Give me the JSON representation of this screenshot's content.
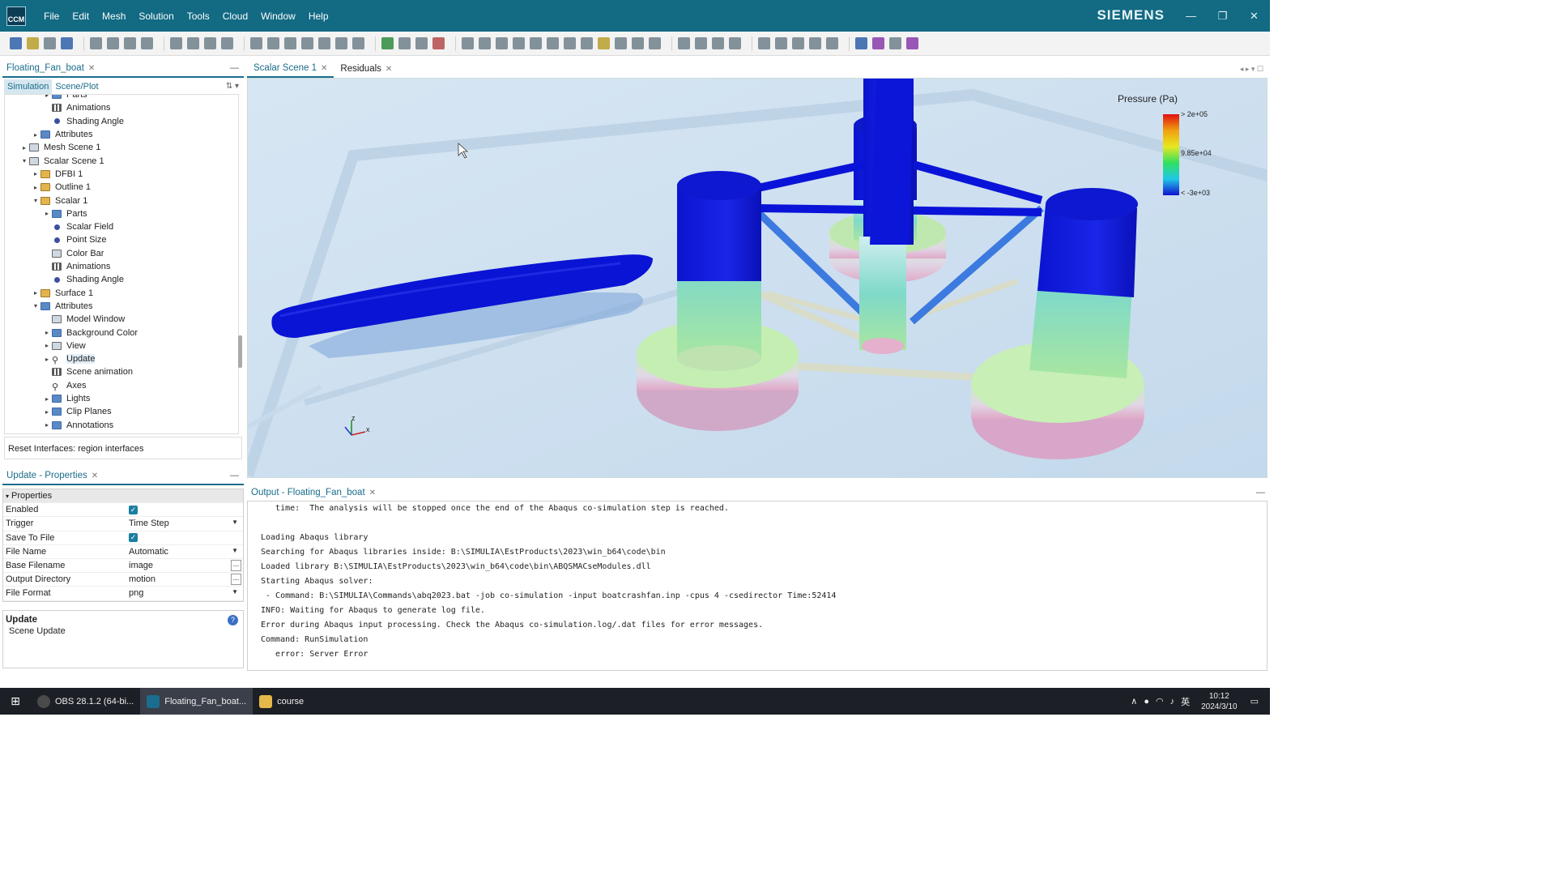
{
  "titlebar": {
    "app_logo": "CCM",
    "menus": [
      "File",
      "Edit",
      "Mesh",
      "Solution",
      "Tools",
      "Cloud",
      "Window",
      "Help"
    ],
    "brand": "SIEMENS"
  },
  "left_panel": {
    "tab_label": "Floating_Fan_boat",
    "subtabs": [
      "Simulation",
      "Scene/Plot"
    ],
    "tree": [
      {
        "label": "Parts",
        "indent": 3,
        "arrow": "▸",
        "icon": "folder"
      },
      {
        "label": "Animations",
        "indent": 3,
        "arrow": "",
        "icon": "anim"
      },
      {
        "label": "Shading Angle",
        "indent": 3,
        "arrow": "",
        "icon": "dot"
      },
      {
        "label": "Attributes",
        "indent": 2,
        "arrow": "▸",
        "icon": "folder"
      },
      {
        "label": "Mesh Scene 1",
        "indent": 1,
        "arrow": "▸",
        "icon": "scene"
      },
      {
        "label": "Scalar Scene 1",
        "indent": 1,
        "arrow": "▾",
        "icon": "scene"
      },
      {
        "label": "DFBI 1",
        "indent": 2,
        "arrow": "▸",
        "icon": "yellow"
      },
      {
        "label": "Outline 1",
        "indent": 2,
        "arrow": "▸",
        "icon": "yellow"
      },
      {
        "label": "Scalar 1",
        "indent": 2,
        "arrow": "▾",
        "icon": "yellow"
      },
      {
        "label": "Parts",
        "indent": 3,
        "arrow": "▸",
        "icon": "folder"
      },
      {
        "label": "Scalar Field",
        "indent": 3,
        "arrow": "",
        "icon": "dot"
      },
      {
        "label": "Point Size",
        "indent": 3,
        "arrow": "",
        "icon": "dot"
      },
      {
        "label": "Color Bar",
        "indent": 3,
        "arrow": "",
        "icon": "scene"
      },
      {
        "label": "Animations",
        "indent": 3,
        "arrow": "",
        "icon": "anim"
      },
      {
        "label": "Shading Angle",
        "indent": 3,
        "arrow": "",
        "icon": "dot"
      },
      {
        "label": "Surface 1",
        "indent": 2,
        "arrow": "▸",
        "icon": "yellow"
      },
      {
        "label": "Attributes",
        "indent": 2,
        "arrow": "▾",
        "icon": "folder"
      },
      {
        "label": "Model Window",
        "indent": 3,
        "arrow": "",
        "icon": "scene"
      },
      {
        "label": "Background Color",
        "indent": 3,
        "arrow": "▸",
        "icon": "folder"
      },
      {
        "label": "View",
        "indent": 3,
        "arrow": "▸",
        "icon": "scene"
      },
      {
        "label": "Update",
        "indent": 3,
        "arrow": "▸",
        "icon": "run",
        "selected": true
      },
      {
        "label": "Scene animation",
        "indent": 3,
        "arrow": "",
        "icon": "anim"
      },
      {
        "label": "Axes",
        "indent": 3,
        "arrow": "",
        "icon": "run"
      },
      {
        "label": "Lights",
        "indent": 3,
        "arrow": "▸",
        "icon": "folder"
      },
      {
        "label": "Clip Planes",
        "indent": 3,
        "arrow": "▸",
        "icon": "folder"
      },
      {
        "label": "Annotations",
        "indent": 3,
        "arrow": "▸",
        "icon": "folder"
      }
    ],
    "status": "Reset Interfaces: region interfaces"
  },
  "properties": {
    "tab_label": "Update - Properties",
    "section": "Properties",
    "rows": [
      {
        "key": "Enabled",
        "value": "",
        "type": "check"
      },
      {
        "key": "Trigger",
        "value": "Time Step",
        "type": "dropdown"
      },
      {
        "key": "Save To File",
        "value": "",
        "type": "check"
      },
      {
        "key": "File Name",
        "value": "Automatic",
        "type": "dropdown"
      },
      {
        "key": "Base Filename",
        "value": "image",
        "type": "dots"
      },
      {
        "key": "Output Directory",
        "value": "motion",
        "type": "dots"
      },
      {
        "key": "File Format",
        "value": "png",
        "type": "dropdown"
      }
    ],
    "help_title": "Update",
    "help_desc": "Scene Update"
  },
  "viewport": {
    "tabs": [
      "Scalar Scene 1",
      "Residuals"
    ],
    "legend": {
      "title": "Pressure (Pa)",
      "max": "> 2e+05",
      "mid": "9.85e+04",
      "min": "< -3e+03"
    },
    "axis_labels": {
      "z": "z",
      "x": "x"
    }
  },
  "output": {
    "tab_label": "Output - Floating_Fan_boat",
    "lines": [
      "   time:  The analysis will be stopped once the end of the Abaqus co-simulation step is reached.",
      "",
      "Loading Abaqus library",
      "Searching for Abaqus libraries inside: B:\\SIMULIA\\EstProducts\\2023\\win_b64\\code\\bin",
      "Loaded library B:\\SIMULIA\\EstProducts\\2023\\win_b64\\code\\bin\\ABQSMACseModules.dll",
      "Starting Abaqus solver:",
      " - Command: B:\\SIMULIA\\Commands\\abq2023.bat -job co-simulation -input boatcrashfan.inp -cpus 4 -csedirector Time:52414",
      "INFO: Waiting for Abaqus to generate log file.",
      "Error during Abaqus input processing. Check the Abaqus co-simulation.log/.dat files for error messages.",
      "Command: RunSimulation",
      "   error: Server Error"
    ]
  },
  "taskbar": {
    "apps": [
      {
        "label": "OBS 28.1.2 (64-bi...",
        "color": "#4a4a4a"
      },
      {
        "label": "Floating_Fan_boat...",
        "color": "#1a6d8c",
        "active": true
      },
      {
        "label": "course",
        "color": "#e5b84a"
      }
    ],
    "ime": "英",
    "time": "10:12",
    "date": "2024/3/10"
  },
  "colors": {
    "accent": "#126a83",
    "hull_blue": "#0a14d8"
  }
}
